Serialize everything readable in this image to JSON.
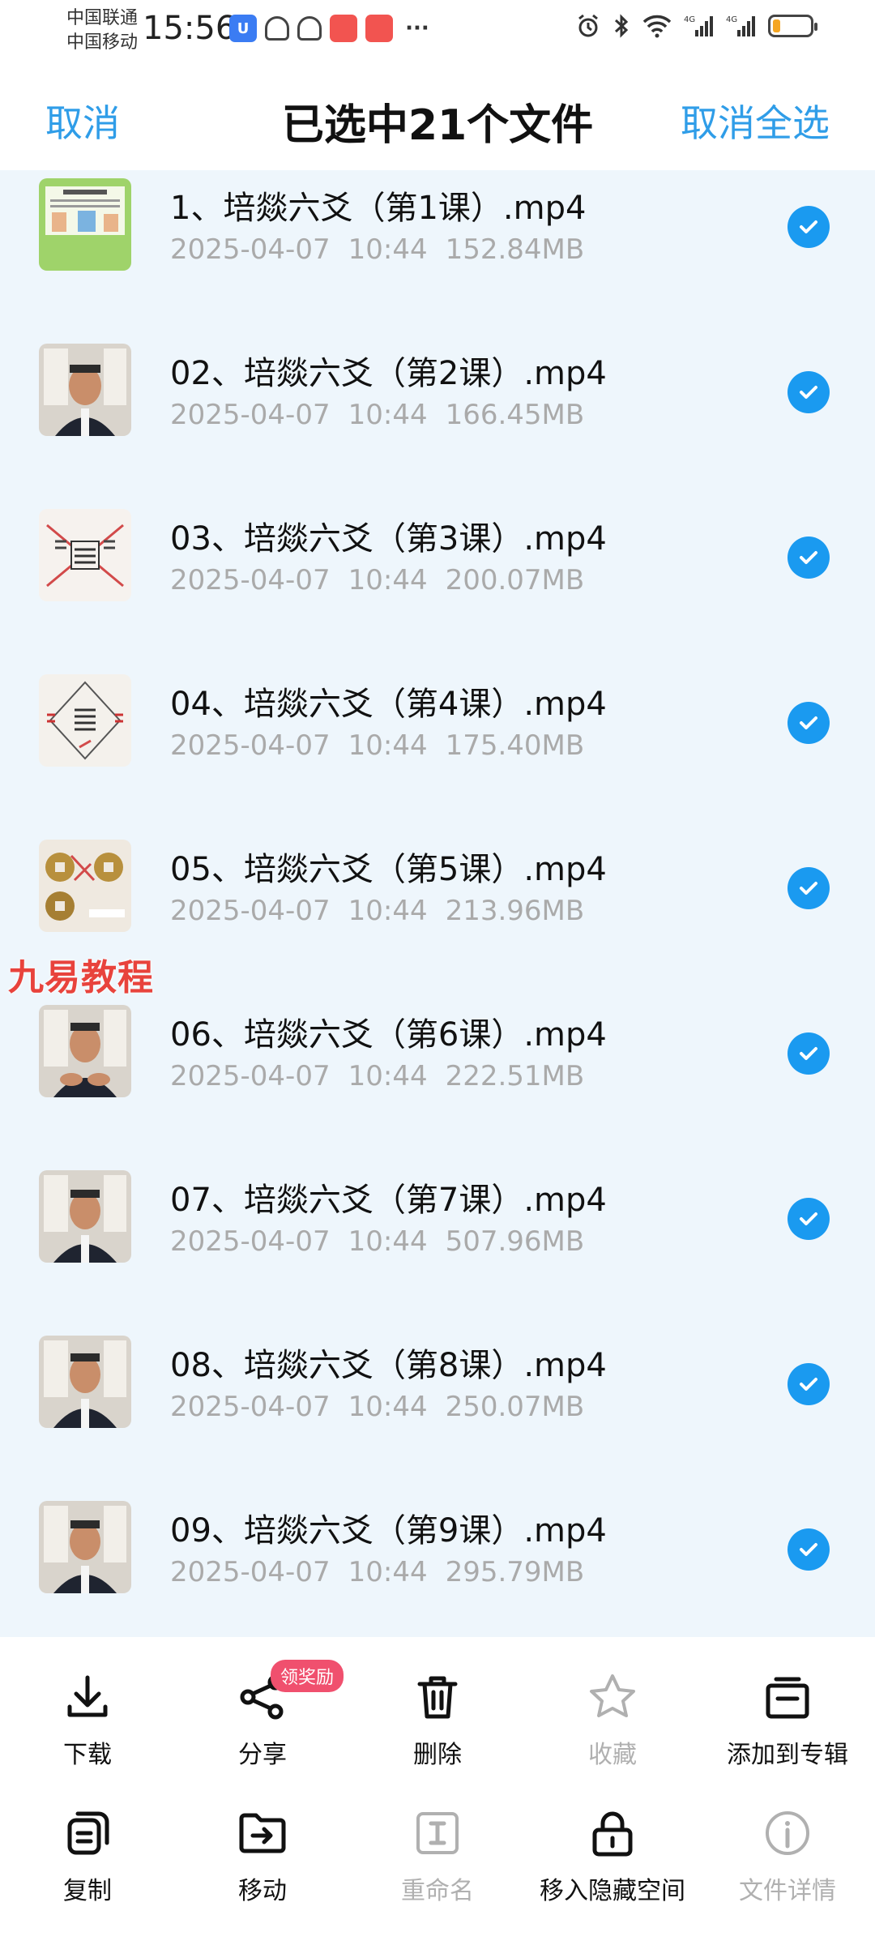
{
  "status_bar": {
    "carrier_1": "中国联通",
    "carrier_2": "中国移动",
    "time": "15:56",
    "more": "···",
    "battery_level": 0.2
  },
  "header": {
    "cancel_label": "取消",
    "title": "已选中21个文件",
    "deselect_all_label": "取消全选"
  },
  "watermark": "九易教程",
  "files": [
    {
      "name": "1、培燚六爻（第1课）.mp4",
      "date": "2025-04-07",
      "time": "10:44",
      "size": "152.84MB",
      "selected": true
    },
    {
      "name": "02、培燚六爻（第2课）.mp4",
      "date": "2025-04-07",
      "time": "10:44",
      "size": "166.45MB",
      "selected": true
    },
    {
      "name": "03、培燚六爻（第3课）.mp4",
      "date": "2025-04-07",
      "time": "10:44",
      "size": "200.07MB",
      "selected": true
    },
    {
      "name": "04、培燚六爻（第4课）.mp4",
      "date": "2025-04-07",
      "time": "10:44",
      "size": "175.40MB",
      "selected": true
    },
    {
      "name": "05、培燚六爻（第5课）.mp4",
      "date": "2025-04-07",
      "time": "10:44",
      "size": "213.96MB",
      "selected": true
    },
    {
      "name": "06、培燚六爻（第6课）.mp4",
      "date": "2025-04-07",
      "time": "10:44",
      "size": "222.51MB",
      "selected": true
    },
    {
      "name": "07、培燚六爻（第7课）.mp4",
      "date": "2025-04-07",
      "time": "10:44",
      "size": "507.96MB",
      "selected": true
    },
    {
      "name": "08、培燚六爻（第8课）.mp4",
      "date": "2025-04-07",
      "time": "10:44",
      "size": "250.07MB",
      "selected": true
    },
    {
      "name": "09、培燚六爻（第9课）.mp4",
      "date": "2025-04-07",
      "time": "10:44",
      "size": "295.79MB",
      "selected": true
    }
  ],
  "actions": {
    "download": "下载",
    "share": "分享",
    "share_badge": "领奖励",
    "delete": "删除",
    "favorite": "收藏",
    "add_to_album": "添加到专辑",
    "copy": "复制",
    "move": "移动",
    "rename": "重命名",
    "move_to_hidden": "移入隐藏空间",
    "file_details": "文件详情"
  },
  "colors": {
    "accent": "#2f9de8",
    "check": "#1a9af0",
    "list_bg": "#eef6fc",
    "badge": "#f0506e",
    "watermark": "#e8433c"
  }
}
